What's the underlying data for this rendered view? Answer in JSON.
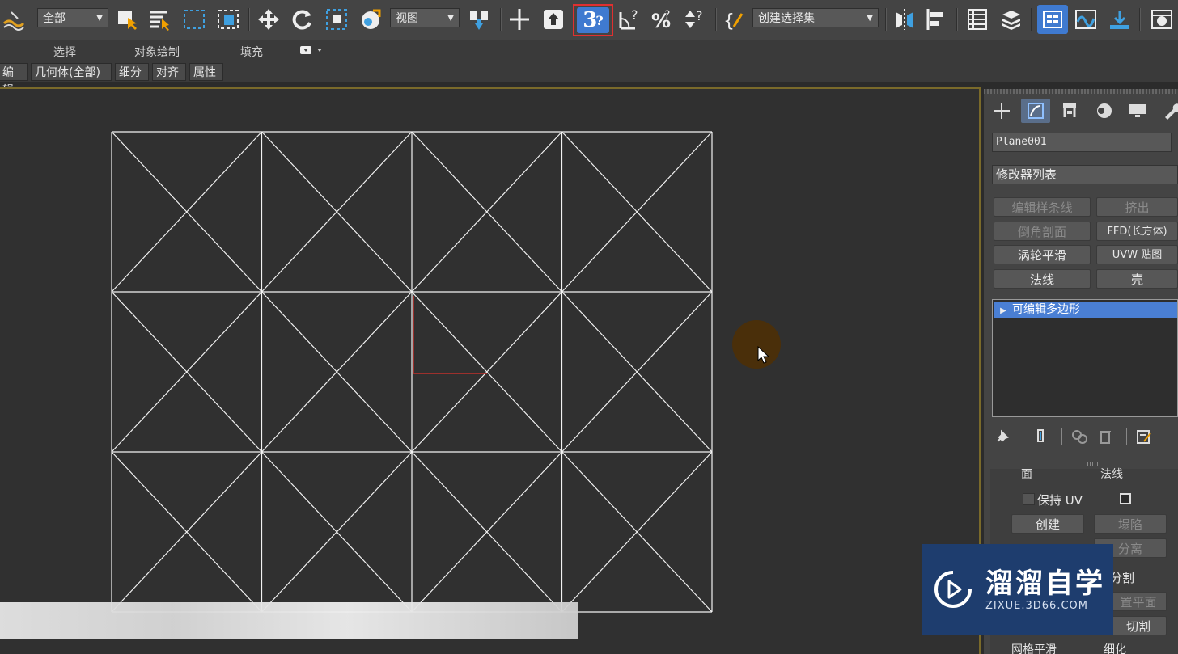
{
  "toolbar": {
    "selection_filter": "全部",
    "reference_coord": "视图",
    "named_selection": "创建选择集",
    "active_tool": "3-angle-snap",
    "accent_color": "#e03030",
    "icons": [
      "ribbon-logo-icon",
      "select-object-icon",
      "select-by-name-icon",
      "rect-select-icon",
      "window-crossing-icon",
      "move-icon",
      "rotate-icon",
      "scale-icon",
      "place-icon",
      "pivot-icon",
      "manipulate-icon",
      "keyboard-shortcut-icon",
      "snap-3d-icon",
      "angle-snap-icon",
      "percent-snap-icon",
      "spinner-snap-icon",
      "edit-named-selection-icon",
      "mirror-icon",
      "align-icon",
      "layer-explorer-icon",
      "layer-manager-icon",
      "scene-explorer-icon",
      "curve-editor-icon",
      "schematic-view-icon",
      "material-editor-icon"
    ]
  },
  "ribbon": {
    "tabs": [
      "选择",
      "对象绘制",
      "填充"
    ]
  },
  "menubar": {
    "tabs": [
      "编辑",
      "几何体(全部)",
      "细分",
      "对齐",
      "属性"
    ]
  },
  "viewport": {
    "grid_cols": 4,
    "grid_rows": 3,
    "wire_color": "#f2f2f2",
    "gizmo_color": "#c0302a"
  },
  "command_panel": {
    "object_name": "Plane001",
    "modifier_list_label": "修改器列表",
    "buttons": [
      {
        "label": "编辑样条线",
        "enabled": false
      },
      {
        "label": "挤出",
        "enabled": false
      },
      {
        "label": "倒角剖面",
        "enabled": false
      },
      {
        "label": "FFD(长方体)",
        "enabled": true
      },
      {
        "label": "涡轮平滑",
        "enabled": true
      },
      {
        "label": "UVW 贴图",
        "enabled": true
      },
      {
        "label": "法线",
        "enabled": true
      },
      {
        "label": "壳",
        "enabled": true
      }
    ],
    "stack_item": "可编辑多边形",
    "stack_highlight": "#4a7fd4",
    "radio_face": "面",
    "radio_normal": "法线",
    "preserve_uv": "保持 UV",
    "create_label": "创建",
    "collapse_label": "塌陷",
    "detach_label": "分离",
    "slice_label": "分割",
    "reset_plane_label": "置平面",
    "cut_label": "切割",
    "msmooth_label": "网格平滑",
    "refine_label": "细化"
  },
  "watermark": {
    "title": "溜溜自学",
    "subtitle": "ZIXUE.3D66.COM"
  }
}
